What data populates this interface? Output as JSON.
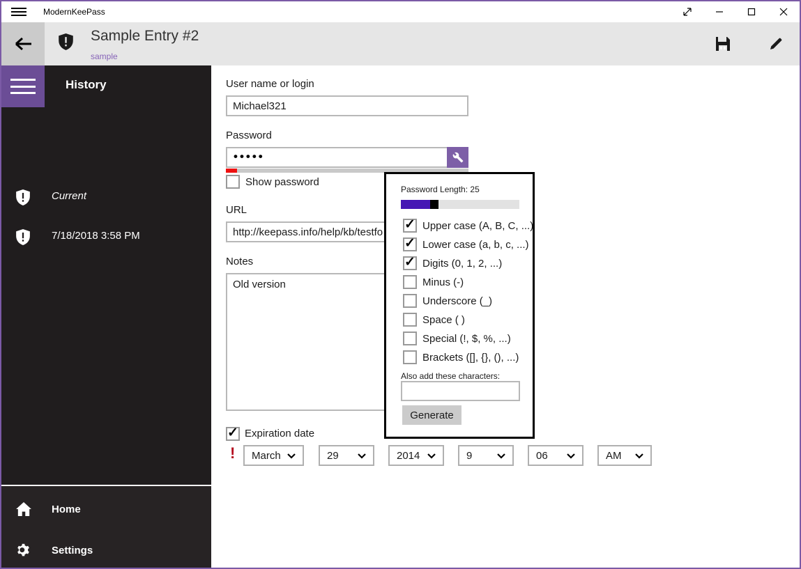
{
  "titlebar": {
    "app_title": "ModernKeePass"
  },
  "header": {
    "title": "Sample Entry #2",
    "subtitle": "sample"
  },
  "sidebar": {
    "section_title": "History",
    "items": [
      {
        "label": "Current"
      },
      {
        "label": "7/18/2018 3:58 PM"
      }
    ],
    "nav": [
      {
        "label": "Home"
      },
      {
        "label": "Settings"
      }
    ]
  },
  "form": {
    "username": {
      "label": "User name or login",
      "value": "Michael321"
    },
    "password": {
      "label": "Password",
      "masked_value": "•••••"
    },
    "show_password_label": "Show password",
    "url": {
      "label": "URL",
      "value": "http://keepass.info/help/kb/testfo"
    },
    "notes": {
      "label": "Notes",
      "value": "Old version"
    },
    "expiration": {
      "label": "Expiration date",
      "checked": true,
      "warning": "!",
      "dropdowns": [
        {
          "value": "March"
        },
        {
          "value": "29"
        },
        {
          "value": "2014"
        },
        {
          "value": "9"
        },
        {
          "value": "06"
        },
        {
          "value": "AM"
        }
      ]
    }
  },
  "generator_popup": {
    "length_label": "Password Length: 25",
    "length_value": 25,
    "options": [
      {
        "label": "Upper case (A, B, C, ...)",
        "checked": true
      },
      {
        "label": "Lower case (a, b, c, ...)",
        "checked": true
      },
      {
        "label": "Digits (0, 1, 2, ...)",
        "checked": true
      },
      {
        "label": "Minus (-)",
        "checked": false
      },
      {
        "label": "Underscore (_)",
        "checked": false
      },
      {
        "label": "Space ( )",
        "checked": false
      },
      {
        "label": "Special (!, $, %, ...)",
        "checked": false
      },
      {
        "label": "Brackets ([], {}, (), ...)",
        "checked": false
      }
    ],
    "also_add_label": "Also add these characters:",
    "also_add_value": "",
    "generate_label": "Generate"
  },
  "glyphs": {
    "check": "✓"
  },
  "colors": {
    "window_border": "#7b5aa6",
    "accent_menu_purple": "#6b4d96",
    "generator_button_purple": "#7d5fa7",
    "slider_fill_purple": "#4617b4",
    "strength_red": "#ee1111",
    "warning_red": "#b50d1f",
    "subtitle_link_purple": "#8764b8",
    "header_bg": "#e6e6e6",
    "sidebar_bg": "#201d1e"
  }
}
